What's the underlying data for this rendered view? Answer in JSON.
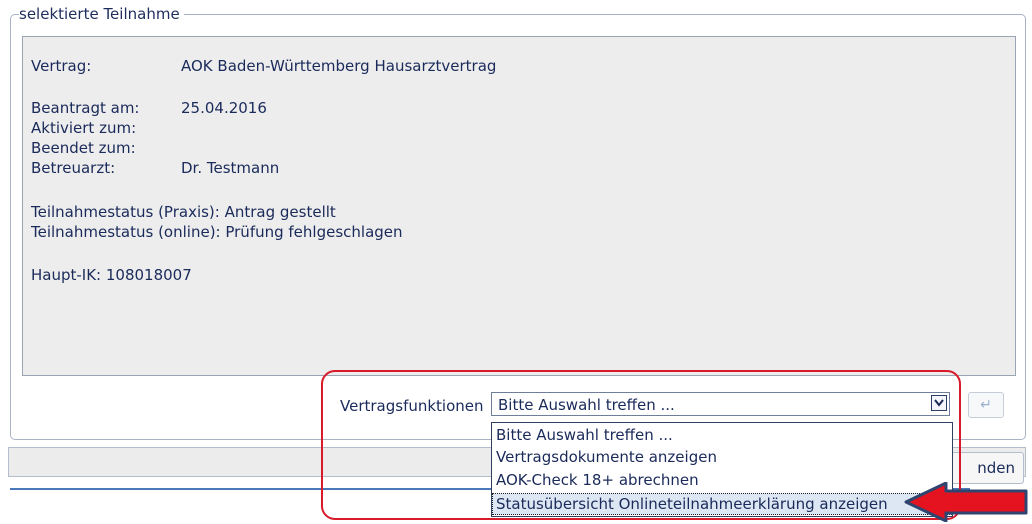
{
  "fieldset": {
    "legend": "selektierte Teilnahme"
  },
  "info": {
    "vertrag_label": "Vertrag:",
    "vertrag_value": "AOK Baden-Württemberg Hausarztvertrag",
    "beantragt_label": "Beantragt am:",
    "beantragt_value": "25.04.2016",
    "aktiviert_label": "Aktiviert zum:",
    "beendet_label": "Beendet zum:",
    "betreuarzt_label": "Betreuarzt:",
    "betreuarzt_value": "Dr. Testmann",
    "status_praxis": "Teilnahmestatus (Praxis): Antrag gestellt",
    "status_online": "Teilnahmestatus (online): Prüfung fehlgeschlagen",
    "haupt_ik": "Haupt-IK: 108018007"
  },
  "functions": {
    "label": "Vertragsfunktionen",
    "selected": "Bitte Auswahl treffen ...",
    "options": [
      "Bitte Auswahl treffen ...",
      "Vertragsdokumente anzeigen",
      "AOK-Check 18+ abrechnen",
      "Statusübersicht Onlineteilnahmeerklärung anzeigen"
    ],
    "highlighted_index": 3
  },
  "exec_button": {
    "symbol": "↵"
  },
  "end_button": {
    "label": "nden"
  },
  "colors": {
    "annotation": "#d81a2a",
    "selection_bg": "#dde6f3",
    "panel_bg": "#ededed"
  },
  "icons": {
    "dropdown": "chevron-down-icon",
    "exec": "enter-arrow-icon",
    "annotation": "red-arrow-icon"
  }
}
